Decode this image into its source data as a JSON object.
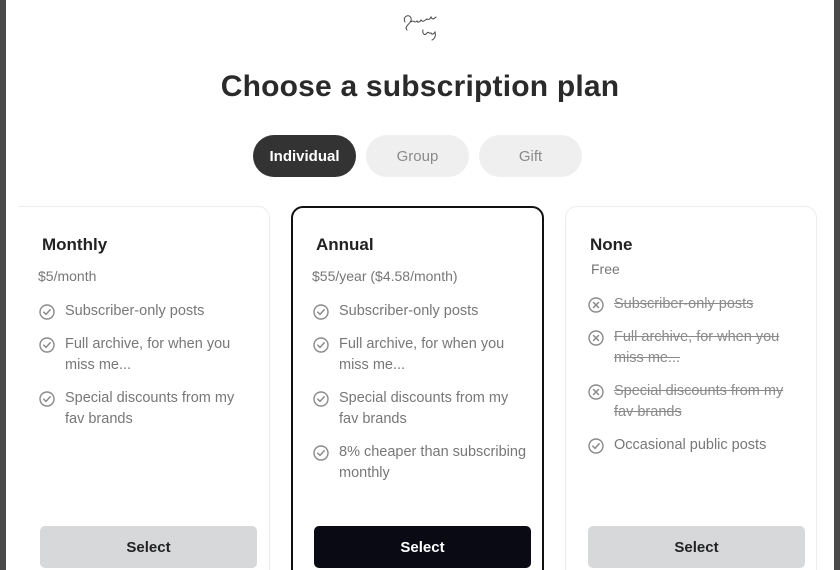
{
  "header": {
    "logo_text": "Sammy's Vlogs",
    "title": "Choose a subscription plan"
  },
  "tabs": [
    {
      "label": "Individual",
      "active": true
    },
    {
      "label": "Group",
      "active": false
    },
    {
      "label": "Gift",
      "active": false
    }
  ],
  "plans": [
    {
      "name": "Monthly",
      "price": "$5/month",
      "features": [
        {
          "text": "Subscriber-only posts",
          "included": true,
          "icon": "check-circle-icon"
        },
        {
          "text": "Full archive, for when you miss me...",
          "included": true,
          "icon": "check-circle-icon"
        },
        {
          "text": "Special discounts from my fav brands",
          "included": true,
          "icon": "check-circle-icon"
        }
      ],
      "button": "Select",
      "selected": false
    },
    {
      "name": "Annual",
      "price": "$55/year ($4.58/month)",
      "features": [
        {
          "text": "Subscriber-only posts",
          "included": true,
          "icon": "check-circle-icon"
        },
        {
          "text": "Full archive, for when you miss me...",
          "included": true,
          "icon": "check-circle-icon"
        },
        {
          "text": "Special discounts from my fav brands",
          "included": true,
          "icon": "check-circle-icon"
        },
        {
          "text": "8% cheaper than subscribing monthly",
          "included": true,
          "icon": "check-circle-icon"
        }
      ],
      "button": "Select",
      "selected": true
    },
    {
      "name": "None",
      "price": "Free",
      "features": [
        {
          "text": "Subscriber-only posts",
          "included": false,
          "icon": "x-circle-icon"
        },
        {
          "text": "Full archive, for when you miss me...",
          "included": false,
          "icon": "x-circle-icon"
        },
        {
          "text": "Special discounts from my fav brands",
          "included": false,
          "icon": "x-circle-icon"
        },
        {
          "text": "Occasional public posts",
          "included": true,
          "icon": "check-circle-icon"
        }
      ],
      "button": "Select",
      "selected": false
    }
  ],
  "colors": {
    "accent": "#0a0a14",
    "tab_active_bg": "#333333",
    "tab_inactive_bg": "#efefef",
    "button_inactive_bg": "#d7d8da",
    "muted_text": "#777777"
  }
}
